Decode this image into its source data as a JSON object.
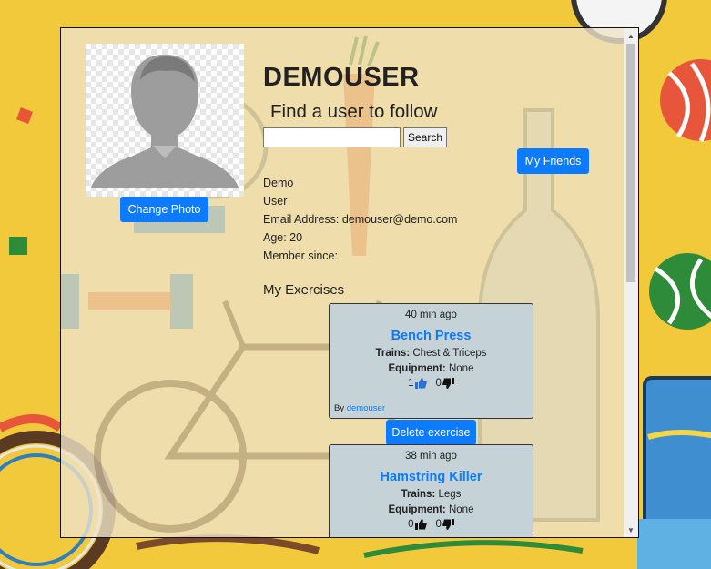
{
  "profile": {
    "username": "DEMOUSER",
    "first_name": "Demo",
    "last_name": "User",
    "email_line": "Email Address: demouser@demo.com",
    "age_line": "Age: 20",
    "member_since_line": "Member since:"
  },
  "buttons": {
    "change_photo": "Change Photo",
    "my_friends": "My Friends",
    "search": "Search",
    "delete_exercise": "Delete exercise"
  },
  "search": {
    "heading": "Find a user to follow",
    "value": ""
  },
  "exercises": {
    "section_title": "My Exercises",
    "items": [
      {
        "time": "40 min ago",
        "title": "Bench Press",
        "trains_label": "Trains:",
        "trains": "Chest & Triceps",
        "equipment_label": "Equipment:",
        "equipment": "None",
        "likes": "1",
        "dislikes": "0",
        "by_label": "By",
        "author": "demouser"
      },
      {
        "time": "38 min ago",
        "title": "Hamstring Killer",
        "trains_label": "Trains:",
        "trains": "Legs",
        "equipment_label": "Equipment:",
        "equipment": "None",
        "likes": "0",
        "dislikes": "0"
      }
    ]
  },
  "colors": {
    "accent": "#0d7bff",
    "card_bg": "#c5d3d9",
    "page_bg": "#f2c93a"
  }
}
